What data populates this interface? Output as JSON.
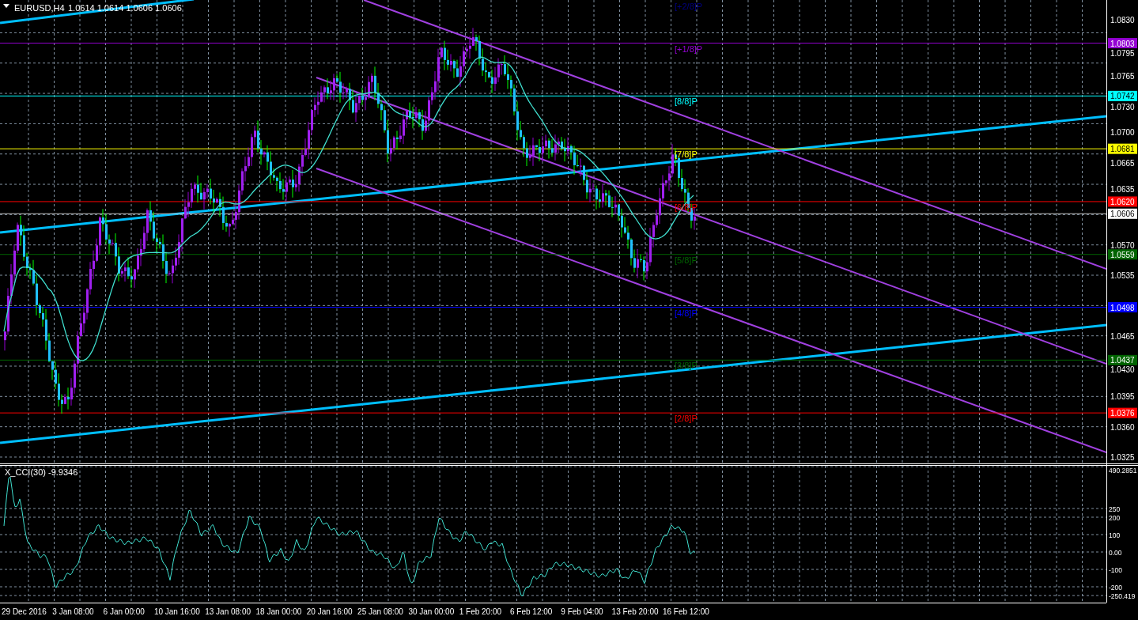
{
  "header": {
    "symbol": "EURUSD,H4",
    "quotes": "1.0614 1.0614 1.0606 1.0606"
  },
  "price_axis": {
    "ticks": [
      "1.0830",
      "1.0795",
      "1.0765",
      "1.0730",
      "1.0700",
      "1.0665",
      "1.0635",
      "1.0570",
      "1.0535",
      "1.0465",
      "1.0430",
      "1.0395",
      "1.0360",
      "1.0325"
    ]
  },
  "levels": [
    {
      "label": "[+2/8]P",
      "color": "#000080"
    },
    {
      "label": "[+1/8]P",
      "tag": "1.0803",
      "color": "#9400d3"
    },
    {
      "label": "[8/8]P",
      "tag": "1.0742",
      "color": "#00ffff"
    },
    {
      "label": "[7/8]P",
      "tag": "1.0681",
      "color": "#ffff00"
    },
    {
      "label": "[6/8]P",
      "tag": "1.0620",
      "color": "#ff0000"
    },
    {
      "label": "[5/8]P",
      "tag": "1.0559",
      "color": "#006400"
    },
    {
      "label": "[4/8]P",
      "tag": "1.0498",
      "color": "#0000ff"
    },
    {
      "label": "[3/8]P",
      "tag": "1.0437",
      "color": "#006400"
    },
    {
      "label": "[2/8]P",
      "tag": "1.0376",
      "color": "#ff0000"
    }
  ],
  "current_price": {
    "tag": "1.0606"
  },
  "indicator": {
    "title": "X_CCI(30) -9.9346",
    "axis_ticks": [
      "490.2851",
      "250",
      "200",
      "100",
      "0.00",
      "-100",
      "-200",
      "-250.419"
    ]
  },
  "time_axis": {
    "labels": [
      "29 Dec 2016",
      "3 Jan 08:00",
      "6 Jan 00:00",
      "10 Jan 16:00",
      "13 Jan 08:00",
      "18 Jan 00:00",
      "20 Jan 16:00",
      "25 Jan 08:00",
      "30 Jan 00:00",
      "1 Feb 20:00",
      "6 Feb 12:00",
      "9 Feb 04:00",
      "13 Feb 20:00",
      "16 Feb 12:00"
    ]
  }
}
